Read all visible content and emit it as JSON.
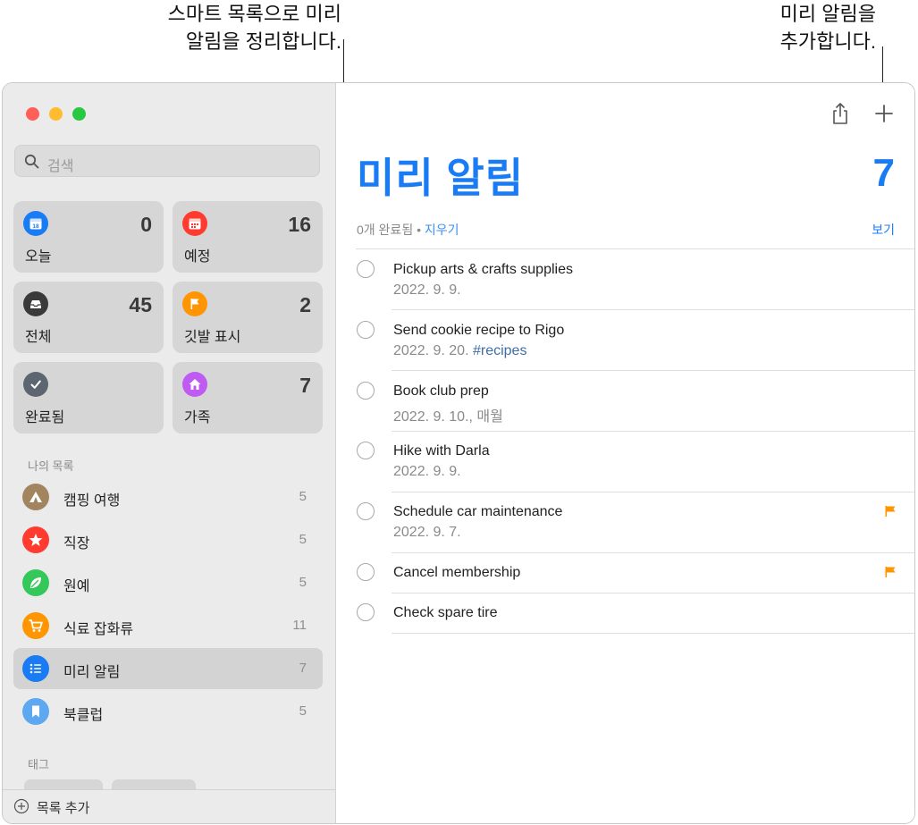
{
  "callouts": {
    "left_line1": "스마트 목록으로 미리",
    "left_line2": "알림을 정리합니다.",
    "right_line1": "미리 알림을",
    "right_line2": "추가합니다."
  },
  "search": {
    "placeholder": "검색"
  },
  "smart_lists": [
    {
      "label": "오늘",
      "count": "0",
      "color": "#1a7cf5",
      "icon": "calendar-today-icon"
    },
    {
      "label": "예정",
      "count": "16",
      "color": "#ff3b30",
      "icon": "calendar-scheduled-icon"
    },
    {
      "label": "전체",
      "count": "45",
      "color": "#3a3a3a",
      "icon": "tray-icon"
    },
    {
      "label": "깃발 표시",
      "count": "2",
      "color": "#ff9500",
      "icon": "flag-icon"
    },
    {
      "label": "완료됨",
      "count": "",
      "color": "#5d6670",
      "icon": "checkmark-icon"
    },
    {
      "label": "가족",
      "count": "7",
      "color": "#bf5af2",
      "icon": "house-icon"
    }
  ],
  "my_lists_header": "나의 목록",
  "my_lists": [
    {
      "name": "캠핑 여행",
      "count": "5",
      "color": "#a2845e",
      "icon": "tent-icon"
    },
    {
      "name": "직장",
      "count": "5",
      "color": "#ff3b30",
      "icon": "star-icon"
    },
    {
      "name": "원예",
      "count": "5",
      "color": "#34c759",
      "icon": "leaf-icon"
    },
    {
      "name": "식료 잡화류",
      "count": "11",
      "color": "#ff9500",
      "icon": "cart-icon"
    },
    {
      "name": "미리 알림",
      "count": "7",
      "color": "#1a7cf5",
      "icon": "list-bullet-icon",
      "selected": true
    },
    {
      "name": "북클럽",
      "count": "5",
      "color": "#5ea8f2",
      "icon": "bookmark-icon"
    }
  ],
  "tags_header": "태그",
  "add_list_label": "목록 추가",
  "main": {
    "title": "미리 알림",
    "count": "7",
    "completed_text": "0개 완료됨",
    "separator": " • ",
    "clear_label": "지우기",
    "view_label": "보기"
  },
  "reminders": [
    {
      "title": "Pickup arts & crafts supplies",
      "date": "2022. 9. 9.",
      "tag": "",
      "flagged": false
    },
    {
      "title": "Send cookie recipe to Rigo",
      "date": "2022. 9. 20.",
      "tag": "#recipes",
      "flagged": false
    },
    {
      "title": "Book club prep",
      "date": "2022. 9. 10., 매월",
      "tag": "",
      "flagged": false
    },
    {
      "title": "Hike with Darla",
      "date": "2022. 9. 9.",
      "tag": "",
      "flagged": false
    },
    {
      "title": "Schedule car maintenance",
      "date": "2022. 9. 7.",
      "tag": "",
      "flagged": true
    },
    {
      "title": "Cancel membership",
      "date": "",
      "tag": "",
      "flagged": true
    },
    {
      "title": "Check spare tire",
      "date": "",
      "tag": "",
      "flagged": false
    }
  ],
  "colors": {
    "accent": "#1a7cf5",
    "flag": "#ff9500"
  }
}
